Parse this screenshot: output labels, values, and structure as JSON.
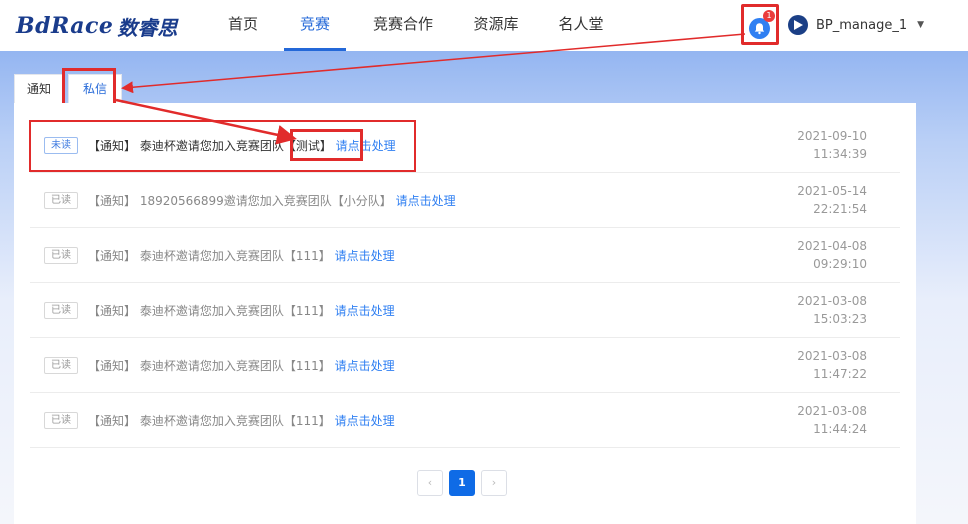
{
  "header": {
    "logo_en": "BdRace",
    "logo_cn": "数睿思",
    "nav": [
      "首页",
      "竞赛",
      "竞赛合作",
      "资源库",
      "名人堂"
    ],
    "active_nav": 1,
    "notification_count": "1",
    "username": "BP_manage_1"
  },
  "tabs": [
    "通知",
    "私信"
  ],
  "active_tab": 1,
  "messages": [
    {
      "status": "未读",
      "text": "【通知】 泰迪杯邀请您加入竞赛团队【测试】",
      "link": "请点击处理",
      "date": "2021-09-10",
      "time": "11:34:39"
    },
    {
      "status": "已读",
      "text": "【通知】 18920566899邀请您加入竞赛团队【小分队】",
      "link": "请点击处理",
      "date": "2021-05-14",
      "time": "22:21:54"
    },
    {
      "status": "已读",
      "text": "【通知】 泰迪杯邀请您加入竞赛团队【111】",
      "link": "请点击处理",
      "date": "2021-04-08",
      "time": "09:29:10"
    },
    {
      "status": "已读",
      "text": "【通知】 泰迪杯邀请您加入竞赛团队【111】",
      "link": "请点击处理",
      "date": "2021-03-08",
      "time": "15:03:23"
    },
    {
      "status": "已读",
      "text": "【通知】 泰迪杯邀请您加入竞赛团队【111】",
      "link": "请点击处理",
      "date": "2021-03-08",
      "time": "11:47:22"
    },
    {
      "status": "已读",
      "text": "【通知】 泰迪杯邀请您加入竞赛团队【111】",
      "link": "请点击处理",
      "date": "2021-03-08",
      "time": "11:44:24"
    }
  ],
  "pagination": {
    "prev": "‹",
    "current": "1",
    "next": "›"
  },
  "colors": {
    "accent": "#2468d8",
    "highlight": "#e12b2b"
  }
}
